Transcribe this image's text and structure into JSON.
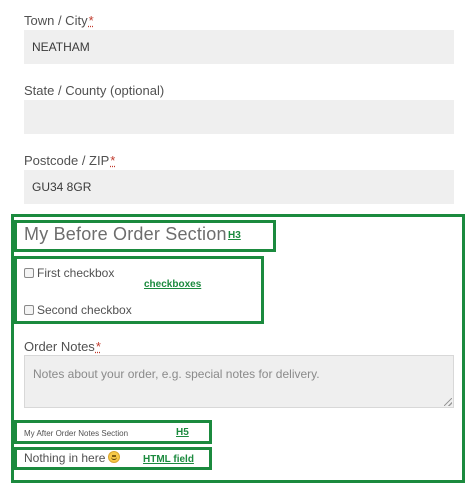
{
  "fields": {
    "city": {
      "label": "Town / City",
      "required_mark": "*",
      "value": "NEATHAM"
    },
    "state": {
      "label": "State / County (optional)",
      "value": ""
    },
    "postcode": {
      "label": "Postcode / ZIP",
      "required_mark": "*",
      "value": "GU34 8GR"
    }
  },
  "before_order": {
    "heading": "My Before Order Section",
    "checkboxes": [
      {
        "label": "First checkbox",
        "checked": false
      },
      {
        "label": "Second checkbox",
        "checked": false
      }
    ]
  },
  "order_notes": {
    "label": "Order Notes",
    "required_mark": "*",
    "placeholder": "Notes about your order, e.g. special notes for delivery."
  },
  "after_notes": {
    "heading": "My After Order Notes Section",
    "html_text": "Nothing in here",
    "emoji_icon": "smiley-icon"
  },
  "annotations": {
    "h3": "H3",
    "checkboxes": "checkboxes",
    "h5": "H5",
    "html_field": "HTML field"
  },
  "colors": {
    "annotation": "#1b8a3e",
    "field_bg": "#efefef",
    "required": "#c0392b"
  }
}
